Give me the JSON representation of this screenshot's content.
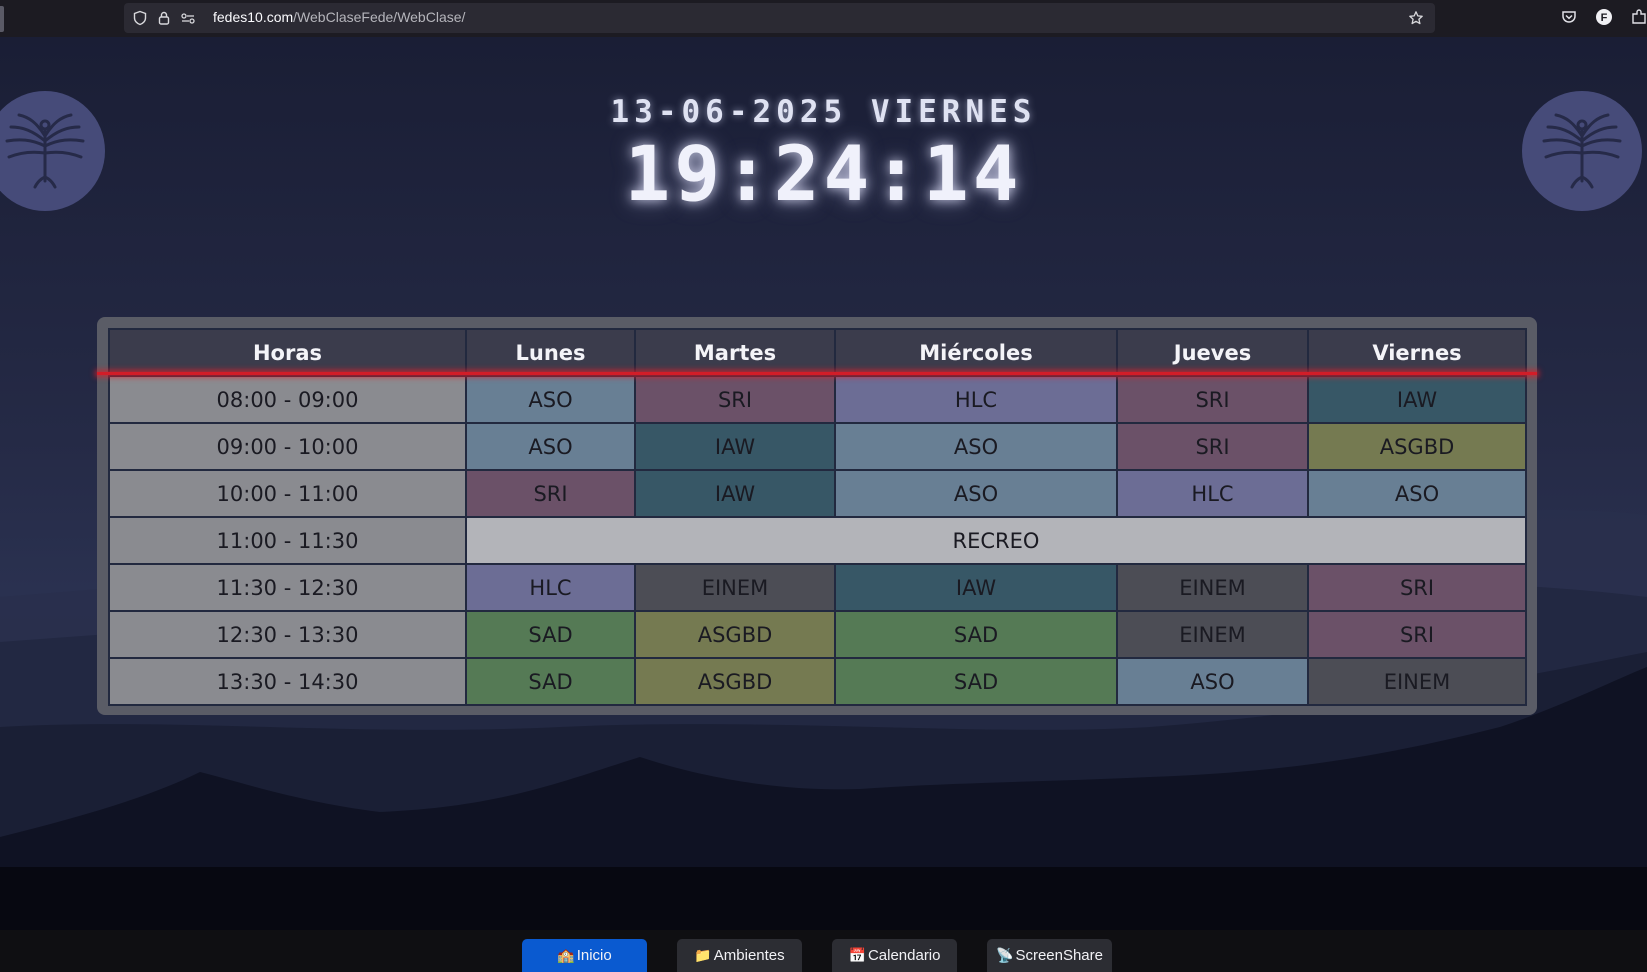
{
  "browser": {
    "url_domain": "fedes10.com",
    "url_path": "/WebClaseFede/WebClase/"
  },
  "clock": {
    "date": "13-06-2025 VIERNES",
    "time": "19:24:14"
  },
  "schedule": {
    "headers": [
      "Horas",
      "Lunes",
      "Martes",
      "Miércoles",
      "Jueves",
      "Viernes"
    ],
    "rows": [
      {
        "hour": "08:00 - 09:00",
        "cells": [
          "ASO",
          "SRI",
          "HLC",
          "SRI",
          "IAW"
        ]
      },
      {
        "hour": "09:00 - 10:00",
        "cells": [
          "ASO",
          "IAW",
          "ASO",
          "SRI",
          "ASGBD"
        ]
      },
      {
        "hour": "10:00 - 11:00",
        "cells": [
          "SRI",
          "IAW",
          "ASO",
          "HLC",
          "ASO"
        ]
      },
      {
        "hour": "11:00 - 11:30",
        "recreo": "RECREO"
      },
      {
        "hour": "11:30 - 12:30",
        "cells": [
          "HLC",
          "EINEM",
          "IAW",
          "EINEM",
          "SRI"
        ]
      },
      {
        "hour": "12:30 - 13:30",
        "cells": [
          "SAD",
          "ASGBD",
          "SAD",
          "EINEM",
          "SRI"
        ]
      },
      {
        "hour": "13:30 - 14:30",
        "cells": [
          "SAD",
          "ASGBD",
          "SAD",
          "ASO",
          "EINEM"
        ]
      }
    ],
    "subject_colors": {
      "ASO": "#687f94",
      "SRI": "#6b5168",
      "HLC": "#6c6d95",
      "IAW": "#375766",
      "ASGBD": "#757a51",
      "EINEM": "#4c4d55",
      "SAD": "#557a55"
    }
  },
  "nav": [
    {
      "label": "Inicio",
      "icon": "🏫",
      "active": true
    },
    {
      "label": "Ambientes",
      "icon": "📁",
      "active": false
    },
    {
      "label": "Calendario",
      "icon": "📅",
      "active": false
    },
    {
      "label": "ScreenShare",
      "icon": "📡",
      "active": false
    }
  ]
}
